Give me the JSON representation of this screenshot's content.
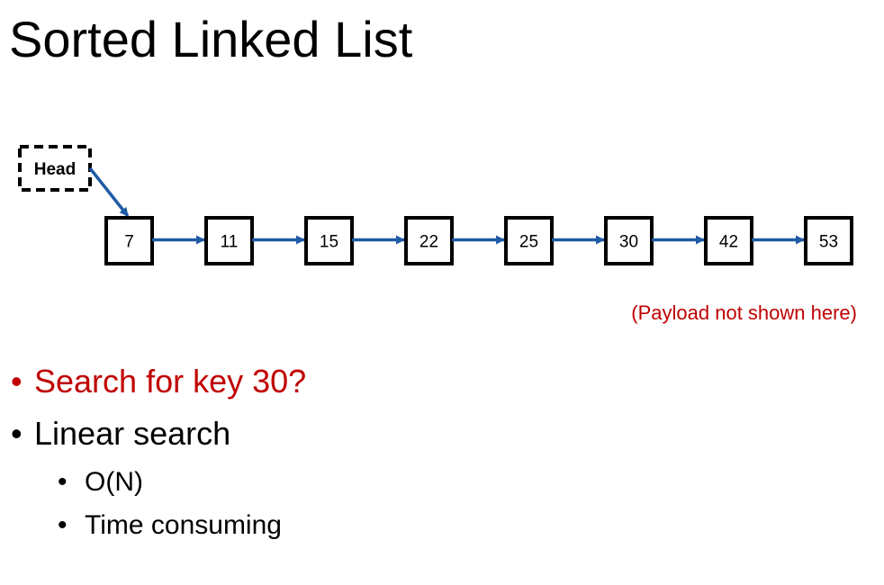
{
  "title": "Sorted Linked List",
  "head_label": "Head",
  "nodes": [
    "7",
    "11",
    "15",
    "22",
    "25",
    "30",
    "42",
    "53"
  ],
  "note": "(Payload not shown here)",
  "bullets": [
    {
      "text": "Search for key 30?",
      "level": 1,
      "highlight": true
    },
    {
      "text": "Linear search",
      "level": 1,
      "highlight": false
    },
    {
      "text": "O(N)",
      "level": 2,
      "highlight": false
    },
    {
      "text": "Time consuming",
      "level": 2,
      "highlight": false
    }
  ],
  "bullet_glyph": "•",
  "colors": {
    "accent": "#c00000",
    "arrow": "#1f5aa6",
    "text": "#000000",
    "box": "#000000"
  }
}
